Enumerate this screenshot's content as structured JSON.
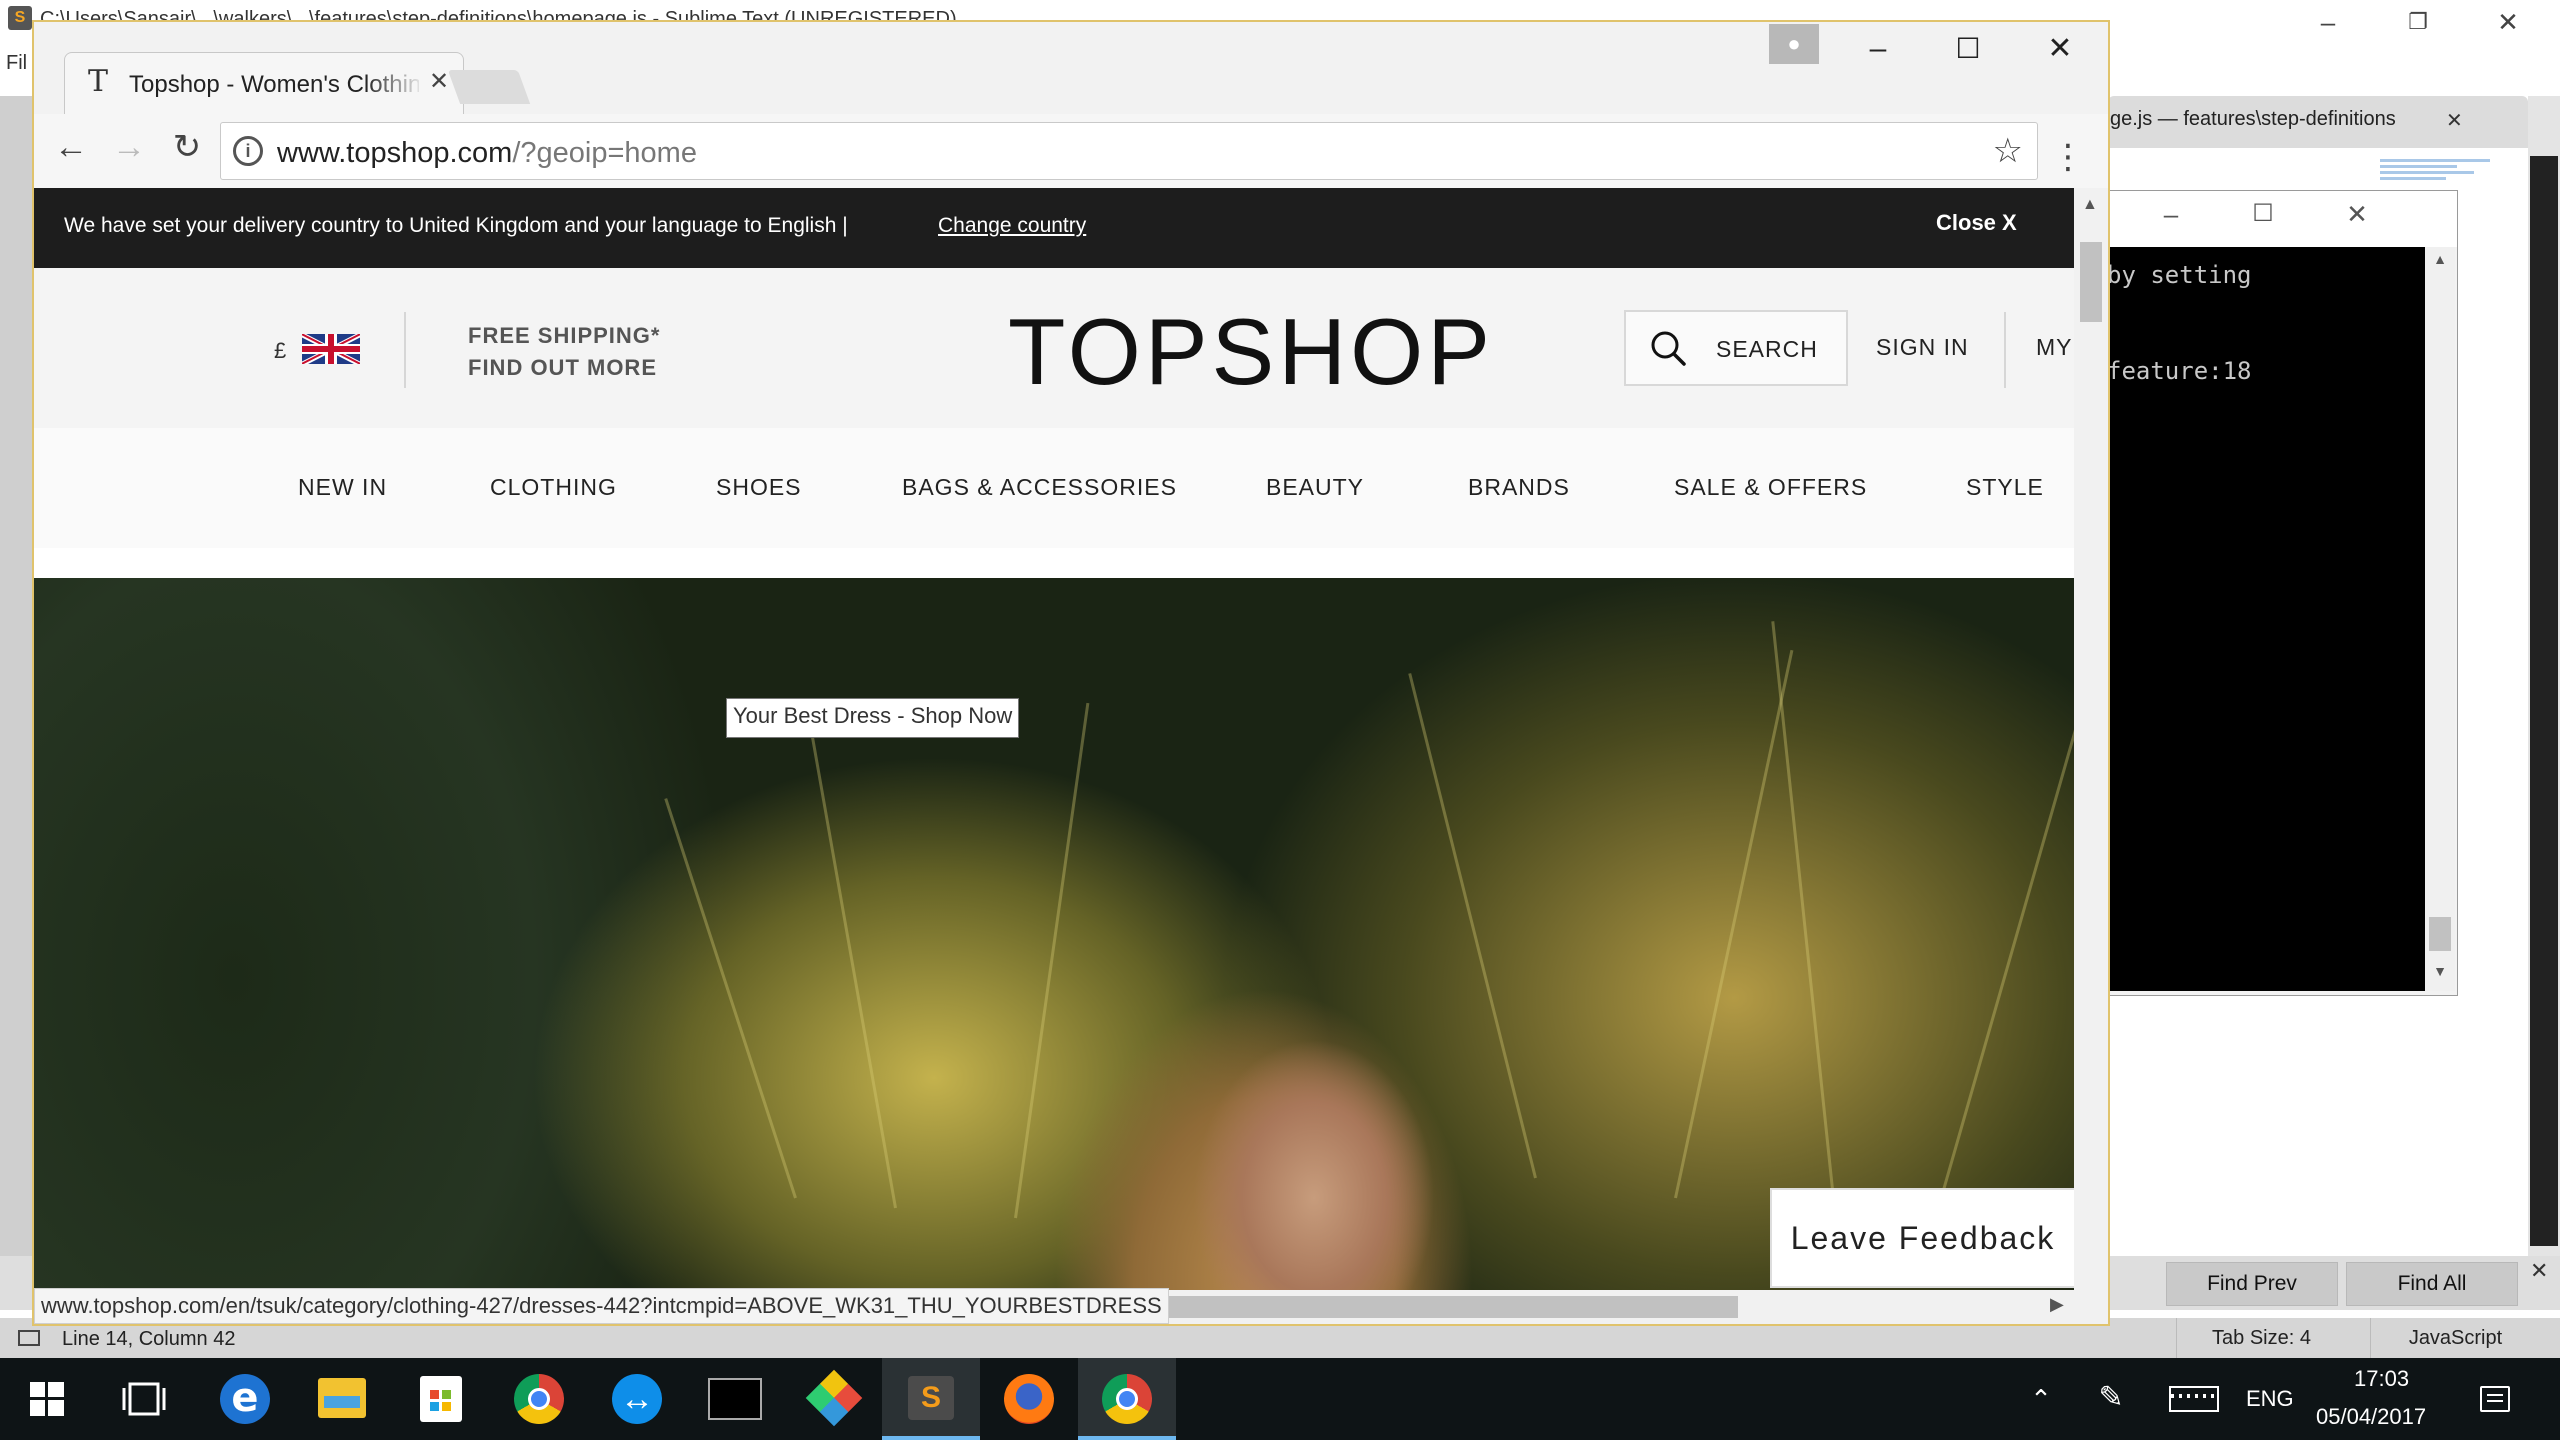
{
  "bg_editor": {
    "title": "C:\\Users\\Sansair\\...\\walkers\\...\\features\\step-definitions\\homepage.js - Sublime Text (UNREGISTERED)",
    "menu_label": "Fil",
    "tab_label": "ge.js — features\\step-definitions",
    "tab_close": "✕",
    "find_prev": "Find Prev",
    "find_all": "Find All",
    "find_close": "✕",
    "status_position": "Line 14, Column 42",
    "tab_size": "Tab Size: 4",
    "syntax": "JavaScript"
  },
  "console": {
    "lines": [
      "by setting",
      "feature:18"
    ]
  },
  "browser": {
    "tab_title": "Topshop - Women's Clothing",
    "tab_favicon": "T",
    "tab_close": "✕",
    "url_host": "www.topshop.com",
    "url_path": "/?geoip=home",
    "status_url": "www.topshop.com/en/tsuk/category/clothing-427/dresses-442?intcmpid=ABOVE_WK31_THU_YOURBESTDRESS"
  },
  "page": {
    "delivery_message": "We have set your delivery country to United Kingdom and your language to English |",
    "change_country": "Change country",
    "close_label": "Close X",
    "currency_symbol": "£",
    "free_shipping_line1": "FREE SHIPPING*",
    "free_shipping_line2": "FIND OUT MORE",
    "logo": "TOPSHOP",
    "search_label": "SEARCH",
    "sign_in_label": "SIGN IN",
    "my_account_label": "MY",
    "nav": [
      "NEW IN",
      "CLOTHING",
      "SHOES",
      "BAGS & ACCESSORIES",
      "BEAUTY",
      "BRANDS",
      "SALE & OFFERS",
      "STYLE"
    ],
    "hero_tooltip": "Your Best Dress - Shop Now",
    "feedback_label": "Leave Feedback"
  },
  "taskbar": {
    "language": "ENG",
    "time": "17:03",
    "date": "05/04/2017"
  },
  "colors": {
    "delivery_bar": "#1d1d1d",
    "taskbar": "#0e1416",
    "window_border": "#e0c36c"
  }
}
